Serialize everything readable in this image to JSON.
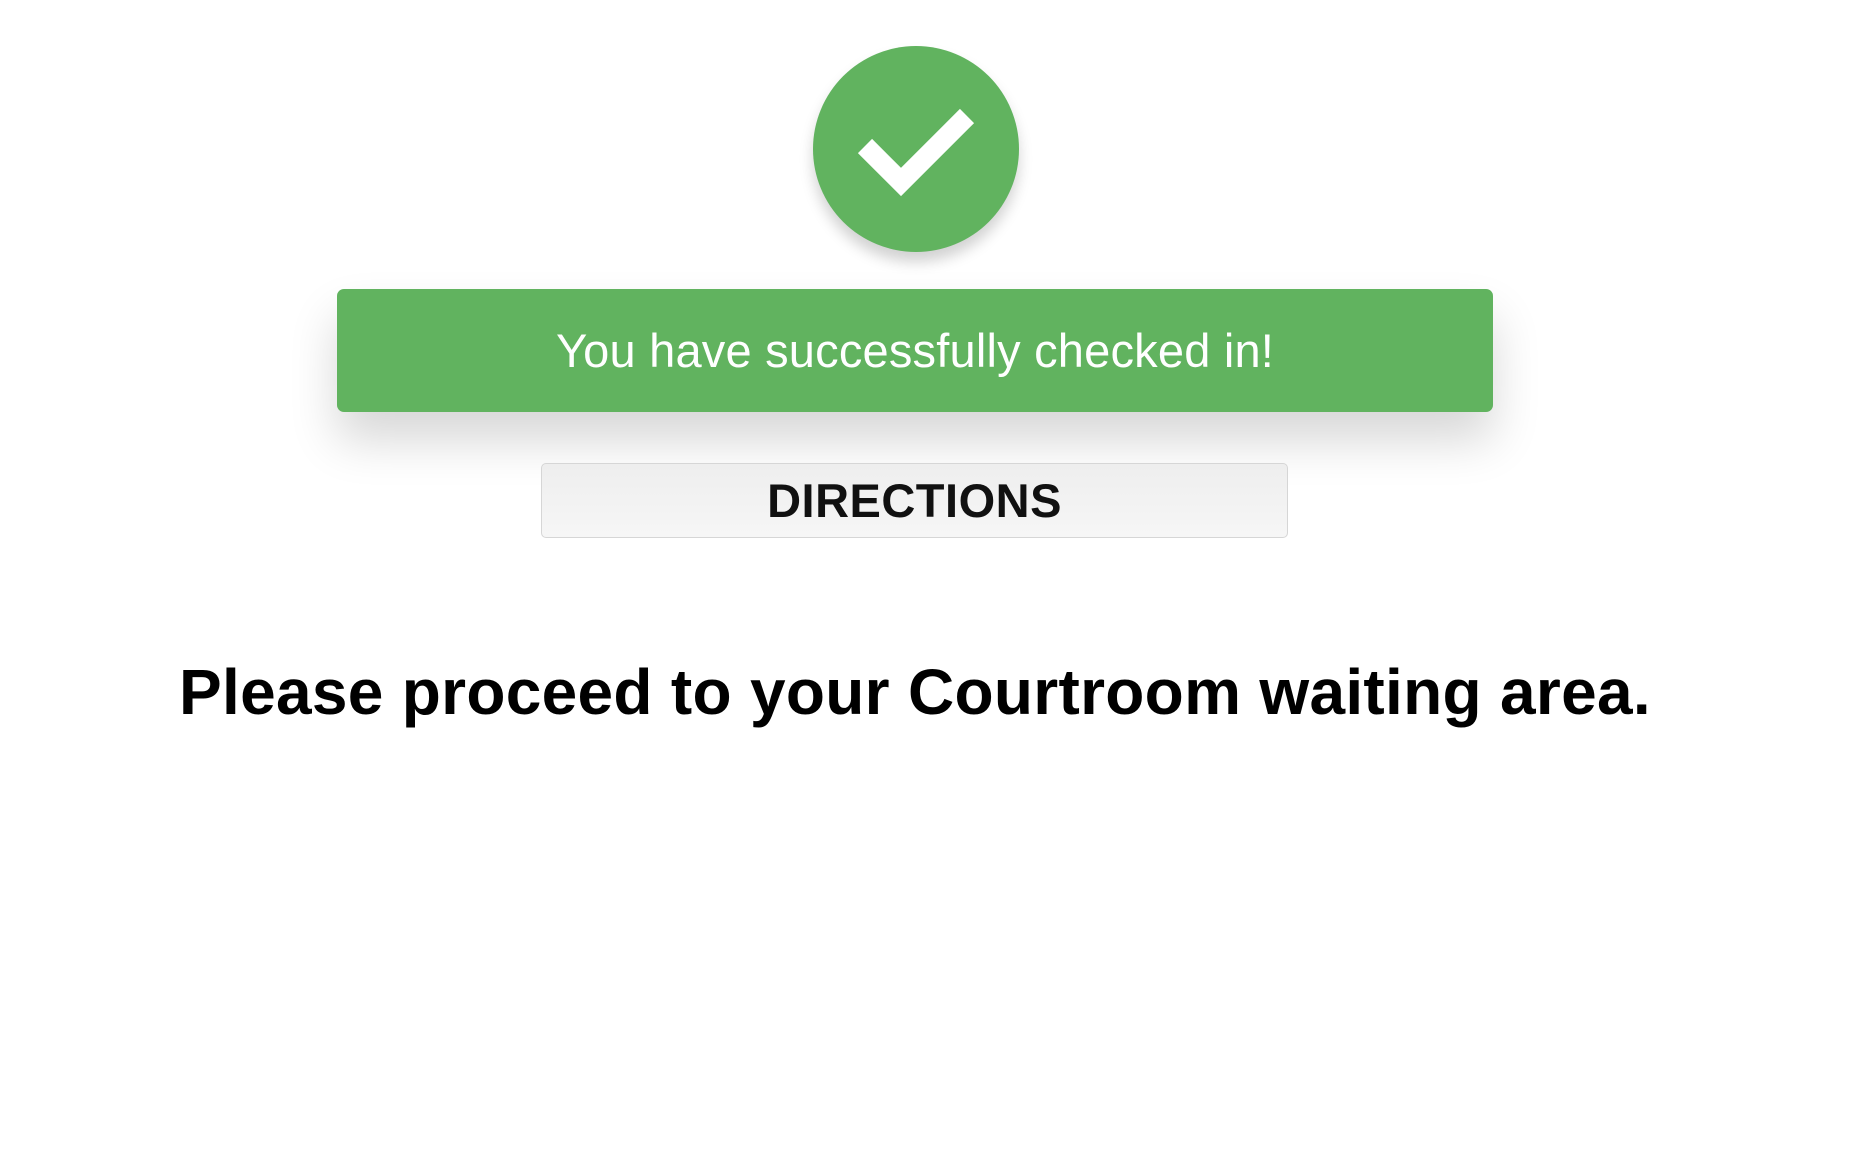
{
  "status": {
    "icon": "checkmark-icon",
    "color": "#61b35f",
    "message": "You have successfully checked in!"
  },
  "directions": {
    "label": "DIRECTIONS"
  },
  "instruction": {
    "text": "Please proceed to your Courtroom waiting area."
  }
}
